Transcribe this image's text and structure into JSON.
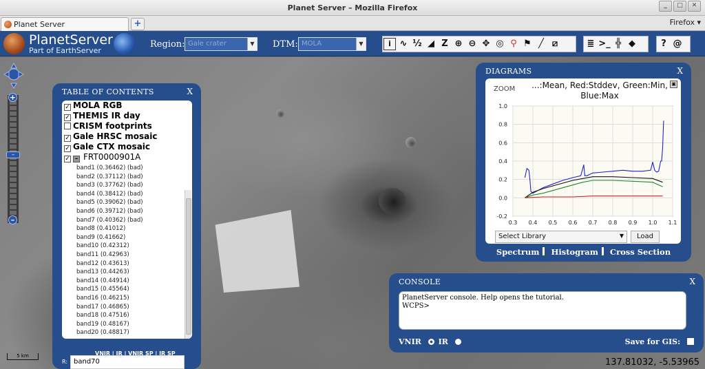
{
  "window": {
    "title": "Planet Server – Mozilla Firefox"
  },
  "browser": {
    "tab_title": "Planet Server",
    "newtab_icon": "plus-icon",
    "menu_label": "Firefox"
  },
  "header": {
    "brand_title": "PlanetServer",
    "brand_subtitle": "Part of EarthServer",
    "region_label": "Region:",
    "region_value": "Gale crater",
    "dtm_label": "DTM:",
    "dtm_value": "MOLA",
    "tools": [
      "info-icon",
      "spectrum-icon",
      "ratio-icon",
      "band-depth-icon",
      "z-scale-icon",
      "zoom-in-icon",
      "zoom-out-icon",
      "pan-icon",
      "globe-icon",
      "search-icon",
      "pin-icon",
      "measure-icon",
      "crop-icon"
    ],
    "tool_glyphs": {
      "ratio": "½",
      "z": "Z"
    },
    "tools2": [
      "list-icon",
      "console-icon",
      "grid-icon",
      "cube-icon"
    ],
    "help_label": "?",
    "at_label": "@"
  },
  "colors": {
    "panel": "#264d8c",
    "accent": "#2c55a8"
  },
  "toc": {
    "title": "TABLE OF CONTENTS",
    "close": "X",
    "layers": [
      {
        "label": "MOLA RGB",
        "checked": true
      },
      {
        "label": "THEMIS IR day",
        "checked": true
      },
      {
        "label": "CRISM footprints",
        "checked": false
      },
      {
        "label": "Gale HRSC mosaic",
        "checked": true
      },
      {
        "label": "Gale CTX mosaic",
        "checked": true
      },
      {
        "label": "FRT0000901A",
        "checked": true
      }
    ],
    "bands": [
      "band1 (0.36462) (bad)",
      "band2 (0.37112) (bad)",
      "band3 (0.37762) (bad)",
      "band4 (0.38412) (bad)",
      "band5 (0.39062) (bad)",
      "band6 (0.39712) (bad)",
      "band7 (0.40362) (bad)",
      "band8 (0.41012)",
      "band9 (0.41662)",
      "band10 (0.42312)",
      "band11 (0.42963)",
      "band12 (0.43613)",
      "band13 (0.44263)",
      "band14 (0.44914)",
      "band15 (0.45564)",
      "band16 (0.46215)",
      "band17 (0.46865)",
      "band18 (0.47516)",
      "band19 (0.48167)",
      "band20 (0.48817)"
    ],
    "tabs_text": "VNIR | IR | VNIR SP | IR SP",
    "r_label": "R:",
    "input_value": "band70"
  },
  "diagrams": {
    "title": "DIAGRAMS",
    "close": "X",
    "zoom_label": "ZOOM",
    "chart_title": "...:Mean, Red:Stddev, Green:Min, Blue:Max",
    "select_library": "Select Library",
    "load_label": "Load",
    "links": [
      "Spectrum",
      "Histogram",
      "Cross Section"
    ]
  },
  "chart_data": {
    "type": "line",
    "title": "...:Mean, Red:Stddev, Green:Min, Blue:Max",
    "xlim": [
      0.3,
      1.1
    ],
    "ylim": [
      -0.2,
      1.0
    ],
    "xticks": [
      "0.3",
      "0.4",
      "0.5",
      "0.6",
      "0.7",
      "0.8",
      "0.9",
      "1.0",
      "1.1"
    ],
    "yticks": [
      "1.0",
      "0.8",
      "0.6",
      "0.4",
      "0.2",
      "0.0",
      "-0.2"
    ],
    "grid": true,
    "series": [
      {
        "name": "Max",
        "color": "#2222cc",
        "x": [
          0.36,
          0.37,
          0.38,
          0.385,
          0.39,
          0.4,
          0.45,
          0.5,
          0.55,
          0.6,
          0.64,
          0.655,
          0.66,
          0.67,
          0.7,
          0.75,
          0.8,
          0.85,
          0.9,
          0.95,
          0.99,
          1.0,
          1.01,
          1.02,
          1.03,
          1.04,
          1.045,
          1.05,
          1.055
        ],
        "y": [
          0.22,
          0.32,
          0.3,
          0.2,
          0.07,
          0.05,
          0.11,
          0.15,
          0.19,
          0.22,
          0.24,
          0.36,
          0.24,
          0.24,
          0.27,
          0.28,
          0.29,
          0.3,
          0.29,
          0.29,
          0.3,
          0.39,
          0.3,
          0.28,
          0.29,
          0.4,
          0.4,
          0.55,
          0.84
        ]
      },
      {
        "name": "Mean",
        "color": "#111111",
        "x": [
          0.36,
          0.4,
          0.45,
          0.5,
          0.55,
          0.6,
          0.65,
          0.7,
          0.8,
          0.9,
          1.0,
          1.05
        ],
        "y": [
          0.0,
          0.06,
          0.1,
          0.13,
          0.16,
          0.19,
          0.21,
          0.23,
          0.23,
          0.22,
          0.21,
          0.17
        ]
      },
      {
        "name": "Min",
        "color": "#22882a",
        "x": [
          0.36,
          0.4,
          0.45,
          0.5,
          0.55,
          0.6,
          0.65,
          0.7,
          0.8,
          0.9,
          1.0,
          1.05
        ],
        "y": [
          0.0,
          0.03,
          0.05,
          0.08,
          0.11,
          0.14,
          0.17,
          0.19,
          0.19,
          0.18,
          0.17,
          0.12
        ]
      },
      {
        "name": "Stddev",
        "color": "#cc2222",
        "x": [
          0.36,
          0.45,
          0.6,
          0.7,
          0.8,
          0.9,
          1.0,
          1.05
        ],
        "y": [
          0.0,
          0.01,
          0.01,
          0.02,
          0.02,
          0.02,
          0.02,
          0.02
        ]
      }
    ]
  },
  "console": {
    "title": "CONSOLE",
    "close": "X",
    "line1": "PlanetServer console. Help opens the tutorial.",
    "line2": "WCPS>",
    "vnir_label": "VNIR",
    "ir_label": "IR",
    "gis_label": "Save for GIS:"
  },
  "map": {
    "coords": "137.81032, -5.53965",
    "scale": "5 km"
  }
}
